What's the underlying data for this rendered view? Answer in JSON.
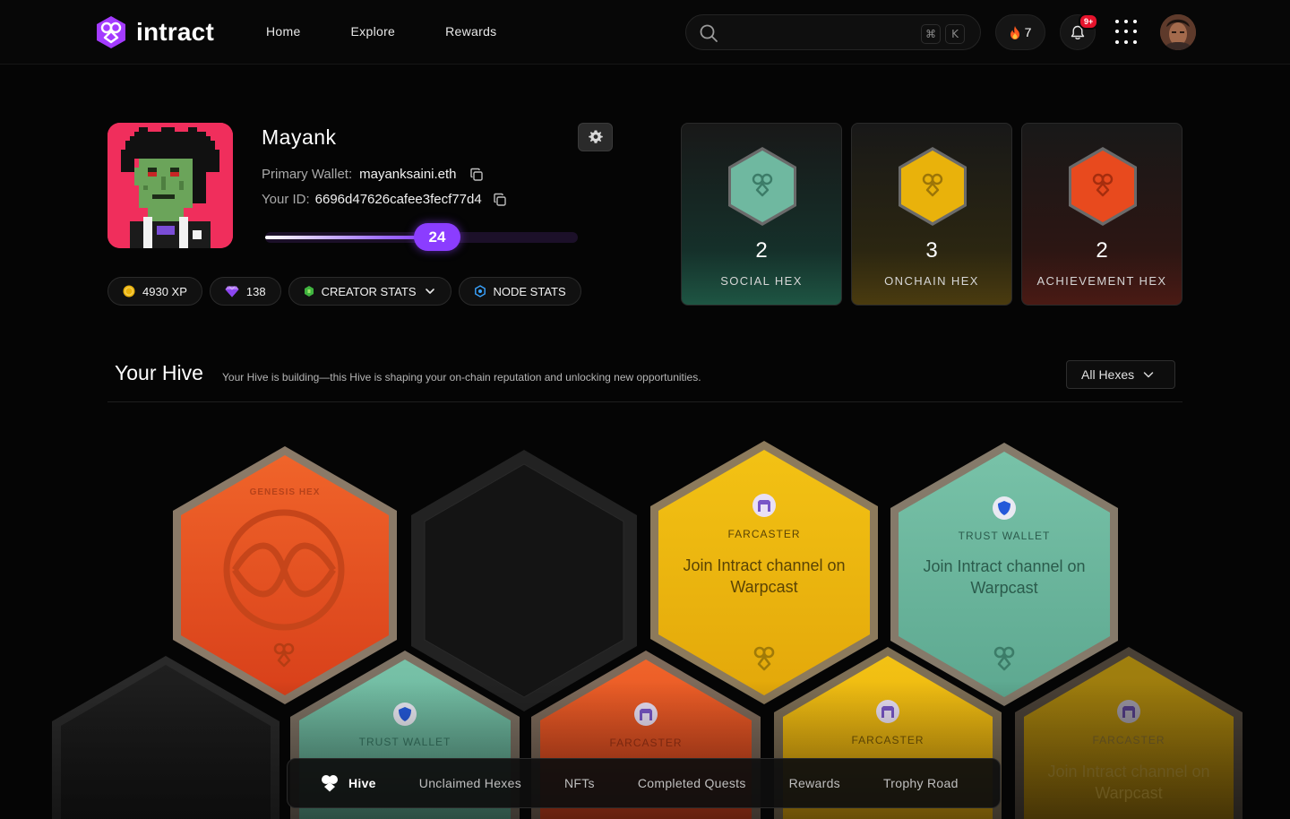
{
  "brand": {
    "name": "intract"
  },
  "nav": {
    "items": [
      "Home",
      "Explore",
      "Rewards"
    ]
  },
  "search": {
    "placeholder": "",
    "shortcut_key1": "⌘",
    "shortcut_key2": "K"
  },
  "header": {
    "streak_count": "7",
    "notifications_badge": "9+"
  },
  "profile": {
    "name": "Mayank",
    "wallet_label": "Primary Wallet:",
    "wallet_value": "mayanksaini.eth",
    "id_label": "Your ID:",
    "id_value": "6696d47626cafee3fecf77d4",
    "level": "24",
    "level_progress": 0.55
  },
  "pills": {
    "xp": "4930 XP",
    "gems": "138",
    "creator_stats": "CREATOR STATS",
    "node_stats": "NODE STATS"
  },
  "hex_cards": [
    {
      "count": "2",
      "label": "SOCIAL HEX",
      "color": "#6fb8a0"
    },
    {
      "count": "3",
      "label": "ONCHAIN HEX",
      "color": "#e9b20b"
    },
    {
      "count": "2",
      "label": "ACHIEVEMENT HEX",
      "color": "#e84a1e"
    }
  ],
  "hive": {
    "title": "Your Hive",
    "subtitle": "Your Hive is building—this Hive is shaping your on-chain reputation and unlocking new opportunities.",
    "filter": "All Hexes",
    "hexes": {
      "genesis": "GENESIS HEX",
      "farcaster_1_platform": "FARCASTER",
      "farcaster_1_title": "Join Intract channel on Warpcast",
      "trust_1_platform": "TRUST WALLET",
      "trust_1_title": "Join Intract channel on Warpcast",
      "trust_2_platform": "TRUST WALLET",
      "farcaster_2_platform": "FARCASTER",
      "farcaster_3_platform": "FARCASTER",
      "farcaster_4_platform": "FARCASTER",
      "farcaster_4_title": "Join Intract channel on Warpcast"
    }
  },
  "tabs": [
    "Hive",
    "Unclaimed Hexes",
    "NFTs",
    "Completed Quests",
    "Rewards",
    "Trophy Road"
  ]
}
